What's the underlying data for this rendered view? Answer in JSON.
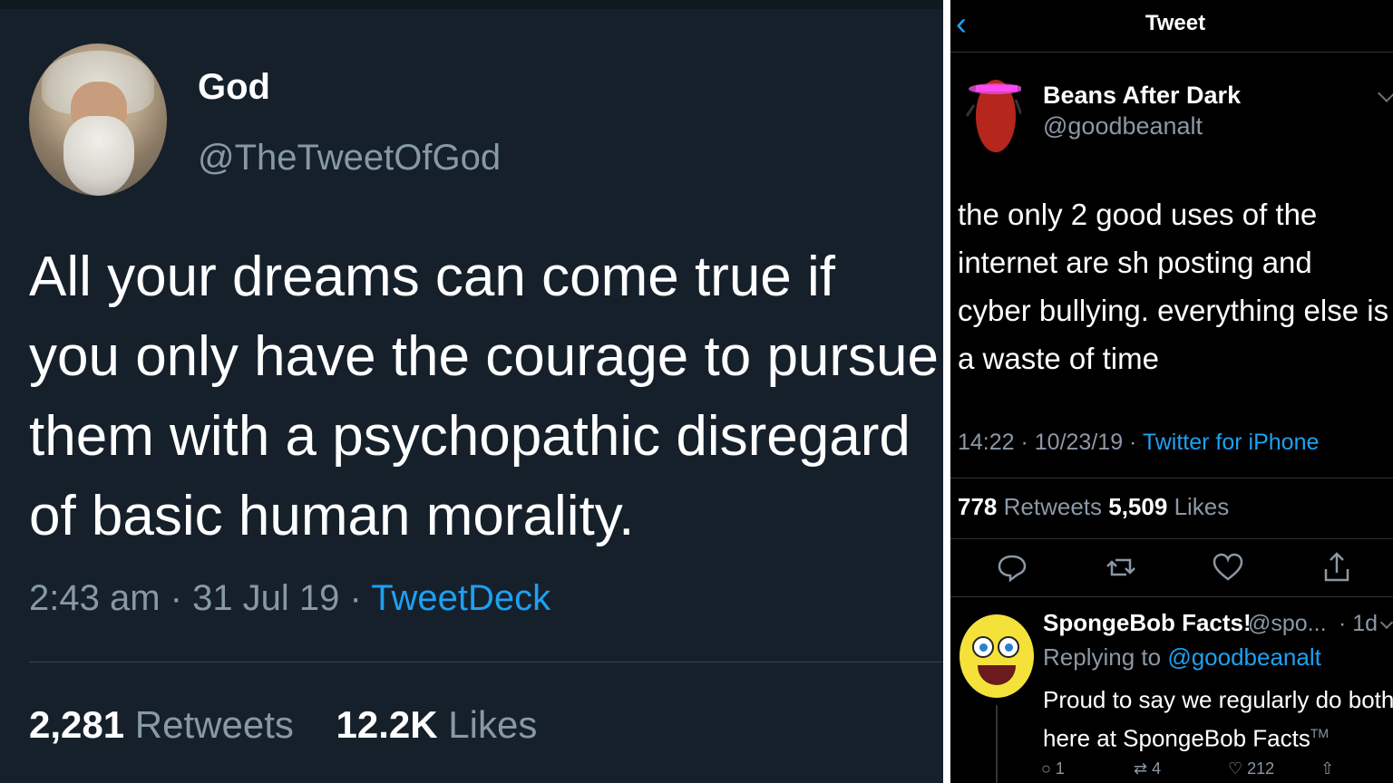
{
  "left": {
    "name": "God",
    "handle": "@TheTweetOfGod",
    "text": "All your dreams can come true if you only have the courage to pursue them with a psychopathic disregard of basic human morality.",
    "meta_prefix": "2:43 am · 31 Jul 19 · ",
    "source": "TweetDeck",
    "retweets_count": "2,281",
    "retweets_label": "Retweets",
    "likes_count": "12.2K",
    "likes_label": "Likes"
  },
  "right": {
    "header_title": "Tweet",
    "back_icon": "chevron-left-icon",
    "name": "Beans After Dark",
    "handle": "@goodbeanalt",
    "text": "the only 2 good uses of the internet are sh  posting and cyber bullying. everything else is a waste of time",
    "time_prefix": "14:22 · 10/23/19 · ",
    "client": "Twitter for iPhone",
    "retweets_count": "778",
    "retweets_label": "Retweets",
    "likes_count": "5,509",
    "likes_label": "Likes",
    "actions": [
      "reply-icon",
      "retweet-icon",
      "like-icon",
      "share-icon"
    ],
    "reply": {
      "name": "SpongeBob Facts!",
      "handle": "@spo...",
      "time": "· 1d",
      "replying_prefix": "Replying to ",
      "replying_to": "@goodbeanalt",
      "text": "Proud to say we regularly do both here at SpongeBob Facts",
      "tm": "TM",
      "reply_count": "1",
      "retweet_count": "4",
      "like_count": "212"
    }
  },
  "colors": {
    "left_bg": "#15202b",
    "right_bg": "#000000",
    "accent": "#1da1f2",
    "muted": "#8899a6"
  }
}
